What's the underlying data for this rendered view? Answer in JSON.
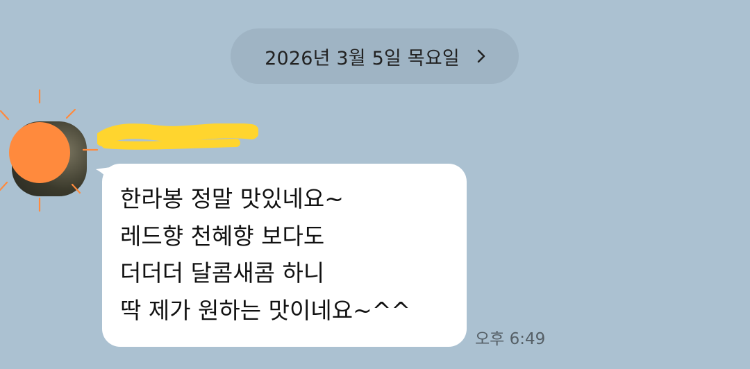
{
  "chat": {
    "background_color": "#abc1d1",
    "date_separator": {
      "label": "2026년 3월 5일 목요일",
      "icon": "chevron-right-icon"
    },
    "message": {
      "sender_name_redacted": "",
      "avatar_colors": {
        "sun": "#ff8a3d",
        "rays": "#ff8a3d"
      },
      "name_mark_color": "#ffd52e",
      "lines": [
        "한라봉 정말 맛있네요~",
        "레드향 천혜향 보다도",
        "더더더 달콤새콤 하니",
        "딱 제가 원하는 맛이네요~^^"
      ],
      "time": "오후 6:49"
    }
  }
}
